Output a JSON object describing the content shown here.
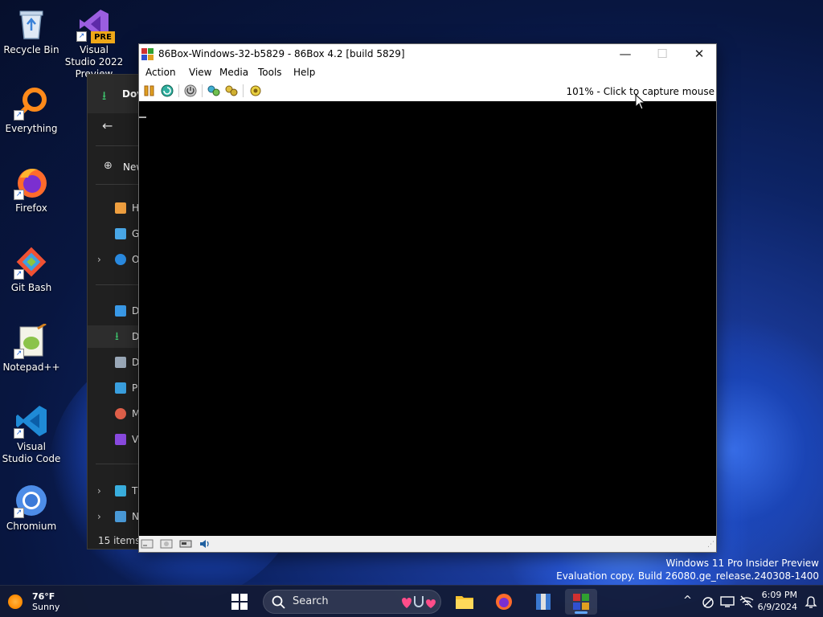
{
  "desktop": {
    "icons": [
      {
        "label": "Recycle Bin",
        "icon": "recycle-bin-icon"
      },
      {
        "label": "Visual Studio 2022 Preview",
        "icon": "visual-studio-preview-icon",
        "badge": "PRE"
      },
      {
        "label": "Everything",
        "icon": "everything-search-icon"
      },
      {
        "label": "Firefox",
        "icon": "firefox-icon"
      },
      {
        "label": "Git Bash",
        "icon": "git-bash-icon"
      },
      {
        "label": "Notepad++",
        "icon": "notepad-plus-plus-icon"
      },
      {
        "label": "Visual Studio Code",
        "icon": "vscode-icon"
      },
      {
        "label": "Chromium",
        "icon": "chromium-icon"
      }
    ]
  },
  "explorer": {
    "header_title": "Dov",
    "new_label": "New",
    "nav_items": [
      {
        "label": "H",
        "icon": "home-icon"
      },
      {
        "label": "G",
        "icon": "gallery-icon"
      },
      {
        "label": "O",
        "icon": "onedrive-icon"
      },
      {
        "label": "D",
        "icon": "desktop-folder-icon"
      },
      {
        "label": "D",
        "icon": "downloads-folder-icon"
      },
      {
        "label": "D",
        "icon": "documents-folder-icon"
      },
      {
        "label": "Pi",
        "icon": "pictures-folder-icon"
      },
      {
        "label": "M",
        "icon": "music-folder-icon"
      },
      {
        "label": "Vi",
        "icon": "videos-folder-icon"
      },
      {
        "label": "Tl",
        "icon": "this-pc-icon"
      },
      {
        "label": "N",
        "icon": "network-icon"
      }
    ],
    "status": "15 items"
  },
  "window": {
    "title": "86Box-Windows-32-b5829 - 86Box 4.2 [build 5829]",
    "controls": {
      "minimize": "—",
      "maximize": "☐",
      "close": "✕"
    },
    "menu": [
      "Action",
      "View",
      "Media",
      "Tools",
      "Help"
    ],
    "toolbar_icons": [
      "pause-icon",
      "reset-icon",
      "power-icon",
      "settings-icon",
      "ctrl-alt-del-icon",
      "screenshot-icon"
    ],
    "capture_hint": "101% - Click to capture mouse",
    "status_icons": [
      "floppy-drive-icon",
      "cdrom-drive-icon",
      "hard-disk-icon",
      "sound-icon"
    ]
  },
  "watermark": {
    "line1": "Windows 11 Pro Insider Preview",
    "line2": "Evaluation copy. Build 26080.ge_release.240308-1400"
  },
  "taskbar": {
    "weather_temp": "76°F",
    "weather_cond": "Sunny",
    "search_placeholder": "Search",
    "pinned": [
      "start-icon",
      "file-explorer-icon",
      "firefox-icon",
      "winrar-icon",
      "86box-icon"
    ],
    "time": "6:09 PM",
    "date": "6/9/2024",
    "tray_chevron": "^"
  },
  "colors": {
    "accent": "#0078d4",
    "desktop_bg": "#0d2466",
    "taskbar_bg": "#121a34",
    "screen_bg": "#000000"
  }
}
